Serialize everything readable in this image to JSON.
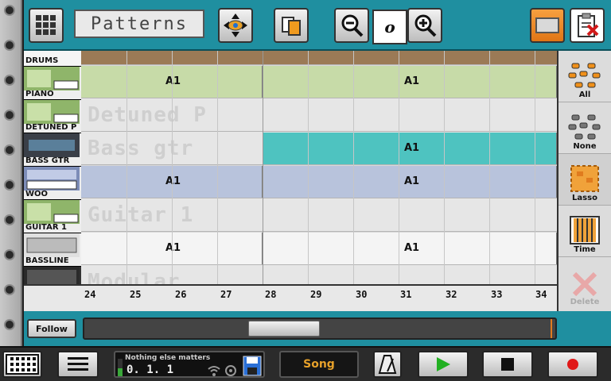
{
  "colors": {
    "topbar": "#1f8fa0",
    "accent_orange": "#e8872a",
    "piano_pattern": "#c7dba8",
    "bass_pattern": "#4ec3c0",
    "woo_pattern": "#b8c3dc",
    "drums_bar": "#9b7a56"
  },
  "topbar": {
    "title": "Patterns",
    "zoom_value": "o",
    "icons": [
      "grid-icon",
      "move-icon",
      "copy-icon",
      "zoom-out-icon",
      "zoom-in-icon",
      "view-toggle-icon",
      "clipboard-delete-icon"
    ]
  },
  "tracks": [
    {
      "name": "Drums"
    },
    {
      "name": "Piano"
    },
    {
      "name": "Detuned P"
    },
    {
      "name": "Bass gtr"
    },
    {
      "name": "Woo"
    },
    {
      "name": "Guitar 1"
    },
    {
      "name": "BassLine"
    },
    {
      "name": "Modular"
    }
  ],
  "grid": {
    "rows": [
      {
        "ghost": "",
        "patterns": [
          {
            "label": ""
          }
        ]
      },
      {
        "ghost": "",
        "patterns": [
          {
            "label": "A1"
          },
          {
            "label": "A1"
          }
        ]
      },
      {
        "ghost": "Detuned P",
        "patterns": []
      },
      {
        "ghost": "Bass gtr",
        "patterns": [
          {
            "label": "A1"
          }
        ]
      },
      {
        "ghost": "",
        "patterns": [
          {
            "label": "A1"
          },
          {
            "label": "A1"
          }
        ]
      },
      {
        "ghost": "Guitar 1",
        "patterns": []
      },
      {
        "ghost": "",
        "patterns": [
          {
            "label": "A1"
          },
          {
            "label": "A1"
          }
        ]
      },
      {
        "ghost": "Modular",
        "patterns": []
      }
    ]
  },
  "ruler": {
    "ticks": [
      "24",
      "25",
      "26",
      "27",
      "28",
      "29",
      "30",
      "31",
      "32",
      "33",
      "34"
    ]
  },
  "tools": [
    {
      "label": "All",
      "icon": "select-all-icon",
      "enabled": true
    },
    {
      "label": "None",
      "icon": "select-none-icon",
      "enabled": true
    },
    {
      "label": "Lasso",
      "icon": "lasso-icon",
      "enabled": true
    },
    {
      "label": "Time",
      "icon": "time-select-icon",
      "enabled": true
    },
    {
      "label": "Delete",
      "icon": "delete-icon",
      "enabled": false
    }
  ],
  "scroll": {
    "follow_label": "Follow"
  },
  "bottombar": {
    "song_name": "Nothing else matters",
    "position": "0. 1. 1",
    "mode": "Song"
  }
}
